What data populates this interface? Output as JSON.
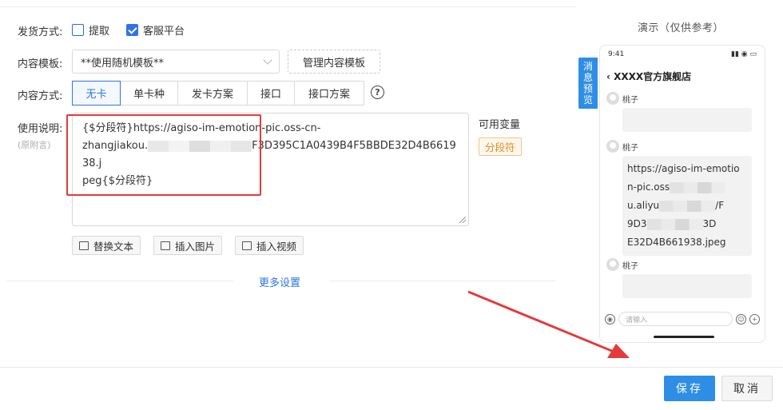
{
  "delivery": {
    "label": "发货方式:",
    "options": [
      {
        "label": "提取",
        "checked": false
      },
      {
        "label": "客服平台",
        "checked": true
      }
    ]
  },
  "template": {
    "label": "内容模板:",
    "selected": "**使用随机模板**",
    "manage_label": "管理内容模板"
  },
  "content_mode": {
    "label": "内容方式:",
    "tabs": [
      {
        "label": "无卡",
        "active": true
      },
      {
        "label": "单卡种",
        "active": false
      },
      {
        "label": "发卡方案",
        "active": false
      },
      {
        "label": "接口",
        "active": false
      },
      {
        "label": "接口方案",
        "active": false
      }
    ],
    "help_icon": "?"
  },
  "instructions": {
    "label": "使用说明:",
    "sublabel": "(原附言)",
    "text_line1": "{$分段符}https://agiso-im-emotion-pic.oss-cn-",
    "text_line2a": "zhangjiakou.",
    "text_line2b": "F3D395C1A0439B4F5BBDE32D4B661938.j",
    "text_line3": "peg{$分段符}"
  },
  "variables": {
    "title": "可用变量",
    "chips": [
      "分段符"
    ]
  },
  "toolbar": {
    "replace_text": "替换文本",
    "insert_image": "插入图片",
    "insert_video": "插入视频"
  },
  "more_settings": "更多设置",
  "demo": {
    "title": "演示（仅供参考）",
    "side_tab": [
      "消",
      "息",
      "预",
      "览"
    ],
    "time": "9:41",
    "status_icons": "▮▮ ◉ ▭",
    "shop_title": "XXXX官方旗舰店",
    "messages": [
      {
        "sender": "桃子"
      },
      {
        "sender": "桃子",
        "lines": [
          "https://agiso-im-emotio",
          "n-pic.oss",
          "u.aliyu",
          "9D3",
          "E32D4B661938.jpeg"
        ],
        "line2_tail": "/F",
        "line4_tail": "3D"
      },
      {
        "sender": "桃子"
      }
    ],
    "input_placeholder": "请输入"
  },
  "footer": {
    "save": "保存",
    "cancel": "取消"
  },
  "colors": {
    "accent": "#2e74e6",
    "save": "#2e8ee6",
    "highlight_box": "#e43a3a",
    "chip": "#e08a1e"
  }
}
